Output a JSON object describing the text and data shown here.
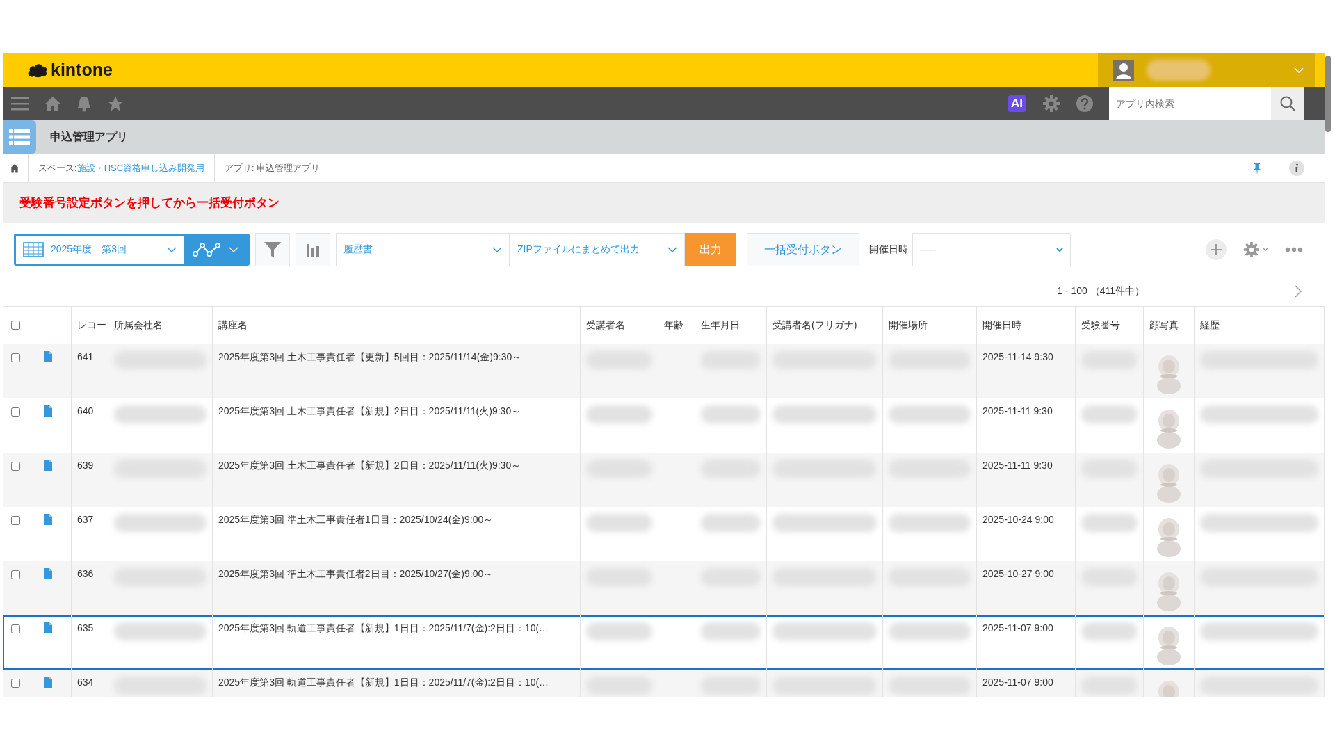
{
  "header": {
    "logo": "kintone",
    "ai_badge": "AI"
  },
  "search": {
    "placeholder": "アプリ内検索"
  },
  "app": {
    "title": "申込管理アプリ"
  },
  "breadcrumb": [
    {
      "prefix": "スペース: ",
      "link": "施設・HSC資格申し込み開発用"
    },
    {
      "prefix": "アプリ: 申込管理アプリ"
    }
  ],
  "notice": "受験番号設定ボタンを押してから一括受付ボタン",
  "toolbar": {
    "view": "2025年度　第3回",
    "template_select": "履歴書",
    "output_select": "ZIPファイルにまとめて出力",
    "output_button": "出力",
    "bulk_button": "一括受付ボタン",
    "date_filter": {
      "label": "開催日時",
      "value": "-----"
    }
  },
  "pagination": "1 - 100 （411件中）",
  "table": {
    "select_all_checked": false,
    "columns": [
      "レコー",
      "所属会社名",
      "講座名",
      "受講者名",
      "年齢",
      "生年月日",
      "受講者名(フリガナ)",
      "開催場所",
      "開催日時",
      "受験番号",
      "顔写真",
      "経歴"
    ],
    "rows": [
      {
        "record": "641",
        "course": "2025年度第3回 土木工事責任者【更新】5回目：2025/11/14(金)9:30～",
        "date": "2025-11-14 9:30",
        "checked": false,
        "selected": false
      },
      {
        "record": "640",
        "course": "2025年度第3回 土木工事責任者【新規】2日目：2025/11/11(火)9:30～",
        "date": "2025-11-11 9:30",
        "checked": false,
        "selected": false
      },
      {
        "record": "639",
        "course": "2025年度第3回 土木工事責任者【新規】2日目：2025/11/11(火)9:30～",
        "date": "2025-11-11 9:30",
        "checked": false,
        "selected": false
      },
      {
        "record": "637",
        "course": "2025年度第3回 準土木工事責任者1日目：2025/10/24(金)9:00～",
        "date": "2025-10-24 9:00",
        "checked": false,
        "selected": false
      },
      {
        "record": "636",
        "course": "2025年度第3回 準土木工事責任者2日目：2025/10/27(金)9:00～",
        "date": "2025-10-27 9:00",
        "checked": false,
        "selected": false
      },
      {
        "record": "635",
        "course": "2025年度第3回 軌道工事責任者【新規】1日目：2025/11/7(金):2日目：10(…",
        "date": "2025-11-07 9:00",
        "checked": false,
        "selected": true
      },
      {
        "record": "634",
        "course": "2025年度第3回 軌道工事責任者【新規】1日目：2025/11/7(金):2日目：10(…",
        "date": "2025-11-07 9:00",
        "checked": false,
        "selected": false
      }
    ]
  }
}
